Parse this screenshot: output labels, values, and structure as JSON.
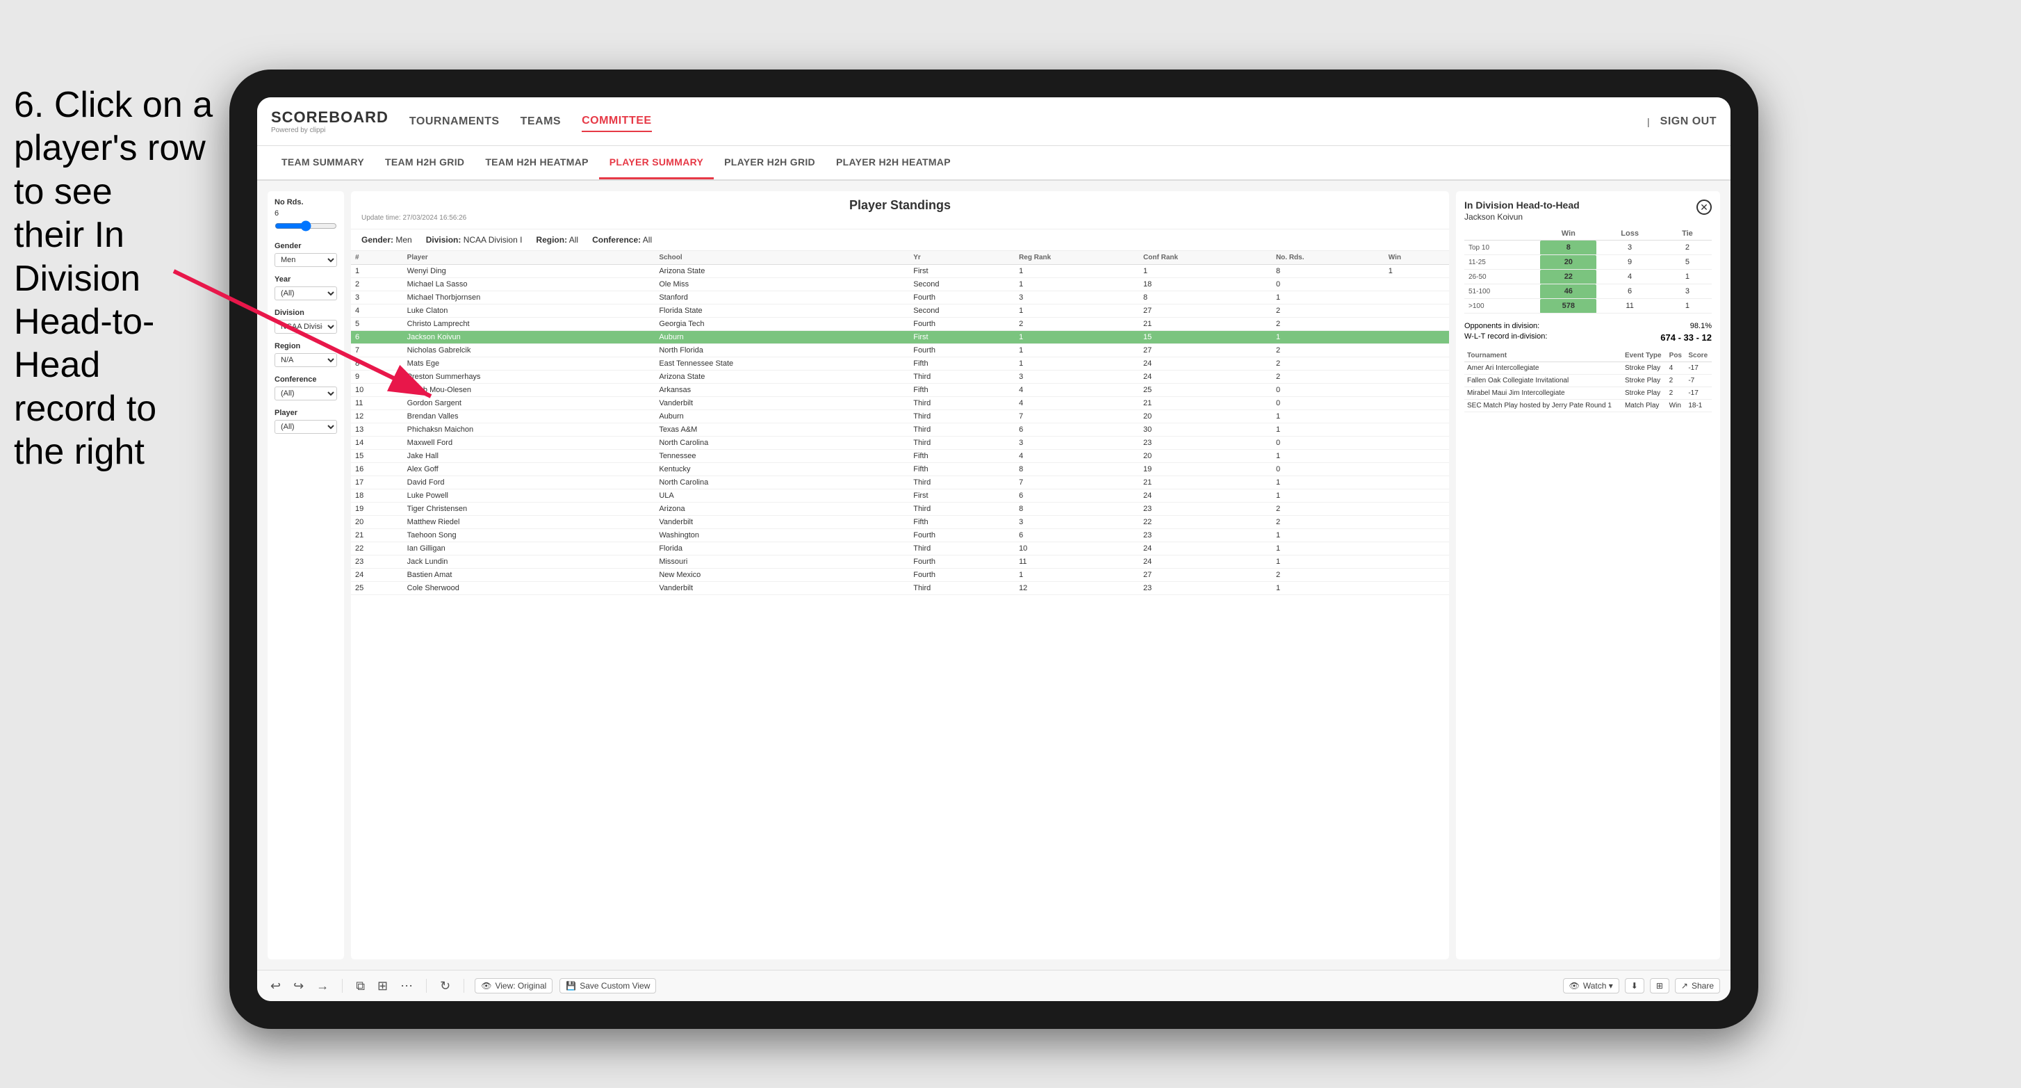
{
  "instruction": {
    "line1": "6. Click on a",
    "line2": "player's row to see",
    "line3": "their In Division",
    "line4": "Head-to-Head",
    "line5": "record to the right"
  },
  "nav": {
    "logo": "SCOREBOARD",
    "logo_sub": "Powered by clippi",
    "items": [
      "TOURNAMENTS",
      "TEAMS",
      "COMMITTEE"
    ],
    "sign_in": "Sign out"
  },
  "sub_nav": {
    "items": [
      "TEAM SUMMARY",
      "TEAM H2H GRID",
      "TEAM H2H HEATMAP",
      "PLAYER SUMMARY",
      "PLAYER H2H GRID",
      "PLAYER H2H HEATMAP"
    ],
    "active": "PLAYER SUMMARY"
  },
  "filters": {
    "no_rds_label": "No Rds.",
    "no_rds_value": "6",
    "gender_label": "Gender",
    "gender_value": "Men",
    "year_label": "Year",
    "year_value": "(All)",
    "division_label": "Division",
    "division_value": "NCAA Division I",
    "region_label": "Region",
    "region_value": "N/A",
    "conference_label": "Conference",
    "conference_value": "(All)",
    "player_label": "Player",
    "player_value": "(All)"
  },
  "standings": {
    "title": "Player Standings",
    "update_time": "Update time:",
    "update_value": "27/03/2024 16:56:26",
    "gender_label": "Gender:",
    "gender_value": "Men",
    "division_label": "Division:",
    "division_value": "NCAA Division I",
    "region_label": "Region:",
    "region_value": "All",
    "conference_label": "Conference:",
    "conference_value": "All",
    "columns": [
      "#",
      "Player",
      "School",
      "Yr",
      "Reg Rank",
      "Conf Rank",
      "No. Rds.",
      "Win"
    ],
    "rows": [
      {
        "num": 1,
        "player": "Wenyi Ding",
        "school": "Arizona State",
        "yr": "First",
        "reg": 1,
        "conf": 1,
        "rds": 8,
        "win": 1
      },
      {
        "num": 2,
        "player": "Michael La Sasso",
        "school": "Ole Miss",
        "yr": "Second",
        "reg": 1,
        "conf": 18,
        "rds": 0
      },
      {
        "num": 3,
        "player": "Michael Thorbjornsen",
        "school": "Stanford",
        "yr": "Fourth",
        "reg": 3,
        "conf": 8,
        "rds": 1
      },
      {
        "num": 4,
        "player": "Luke Claton",
        "school": "Florida State",
        "yr": "Second",
        "reg": 1,
        "conf": 27,
        "rds": 2
      },
      {
        "num": 5,
        "player": "Christo Lamprecht",
        "school": "Georgia Tech",
        "yr": "Fourth",
        "reg": 2,
        "conf": 21,
        "rds": 2
      },
      {
        "num": 6,
        "player": "Jackson Koivun",
        "school": "Auburn",
        "yr": "First",
        "reg": 1,
        "conf": 15,
        "rds": 1,
        "highlighted": true
      },
      {
        "num": 7,
        "player": "Nicholas Gabrelcik",
        "school": "North Florida",
        "yr": "Fourth",
        "reg": 1,
        "conf": 27,
        "rds": 2
      },
      {
        "num": 8,
        "player": "Mats Ege",
        "school": "East Tennessee State",
        "yr": "Fifth",
        "reg": 1,
        "conf": 24,
        "rds": 2
      },
      {
        "num": 9,
        "player": "Preston Summerhays",
        "school": "Arizona State",
        "yr": "Third",
        "reg": 3,
        "conf": 24,
        "rds": 2
      },
      {
        "num": 10,
        "player": "Jacob Mou-Olesen",
        "school": "Arkansas",
        "yr": "Fifth",
        "reg": 4,
        "conf": 25,
        "rds": 0
      },
      {
        "num": 11,
        "player": "Gordon Sargent",
        "school": "Vanderbilt",
        "yr": "Third",
        "reg": 4,
        "conf": 21,
        "rds": 0
      },
      {
        "num": 12,
        "player": "Brendan Valles",
        "school": "Auburn",
        "yr": "Third",
        "reg": 7,
        "conf": 20,
        "rds": 1
      },
      {
        "num": 13,
        "player": "Phichaksn Maichon",
        "school": "Texas A&M",
        "yr": "Third",
        "reg": 6,
        "conf": 30,
        "rds": 1
      },
      {
        "num": 14,
        "player": "Maxwell Ford",
        "school": "North Carolina",
        "yr": "Third",
        "reg": 3,
        "conf": 23,
        "rds": 0
      },
      {
        "num": 15,
        "player": "Jake Hall",
        "school": "Tennessee",
        "yr": "Fifth",
        "reg": 4,
        "conf": 20,
        "rds": 1
      },
      {
        "num": 16,
        "player": "Alex Goff",
        "school": "Kentucky",
        "yr": "Fifth",
        "reg": 8,
        "conf": 19,
        "rds": 0
      },
      {
        "num": 17,
        "player": "David Ford",
        "school": "North Carolina",
        "yr": "Third",
        "reg": 7,
        "conf": 21,
        "rds": 1
      },
      {
        "num": 18,
        "player": "Luke Powell",
        "school": "ULA",
        "yr": "First",
        "reg": 6,
        "conf": 24,
        "rds": 1
      },
      {
        "num": 19,
        "player": "Tiger Christensen",
        "school": "Arizona",
        "yr": "Third",
        "reg": 8,
        "conf": 23,
        "rds": 2
      },
      {
        "num": 20,
        "player": "Matthew Riedel",
        "school": "Vanderbilt",
        "yr": "Fifth",
        "reg": 3,
        "conf": 22,
        "rds": 2
      },
      {
        "num": 21,
        "player": "Taehoon Song",
        "school": "Washington",
        "yr": "Fourth",
        "reg": 6,
        "conf": 23,
        "rds": 1
      },
      {
        "num": 22,
        "player": "Ian Gilligan",
        "school": "Florida",
        "yr": "Third",
        "reg": 10,
        "conf": 24,
        "rds": 1
      },
      {
        "num": 23,
        "player": "Jack Lundin",
        "school": "Missouri",
        "yr": "Fourth",
        "reg": 11,
        "conf": 24,
        "rds": 1
      },
      {
        "num": 24,
        "player": "Bastien Amat",
        "school": "New Mexico",
        "yr": "Fourth",
        "reg": 1,
        "conf": 27,
        "rds": 2
      },
      {
        "num": 25,
        "player": "Cole Sherwood",
        "school": "Vanderbilt",
        "yr": "Third",
        "reg": 12,
        "conf": 23,
        "rds": 1
      }
    ]
  },
  "h2h": {
    "title": "In Division Head-to-Head",
    "player_name": "Jackson Koivun",
    "table_headers": [
      "Win",
      "Loss",
      "Tie"
    ],
    "rows": [
      {
        "label": "Top 10",
        "win": 8,
        "loss": 3,
        "tie": 2
      },
      {
        "label": "11-25",
        "win": 20,
        "loss": 9,
        "tie": 5
      },
      {
        "label": "26-50",
        "win": 22,
        "loss": 4,
        "tie": 1
      },
      {
        "label": "51-100",
        "win": 46,
        "loss": 6,
        "tie": 3
      },
      {
        "label": ">100",
        "win": 578,
        "loss": 11,
        "tie": 1
      }
    ],
    "opponents_label": "Opponents in division:",
    "opponents_value": "98.1%",
    "wlt_label": "W-L-T record in-division:",
    "wlt_value": "674 - 33 - 12",
    "tournaments_columns": [
      "Tournament",
      "Event Type",
      "Pos",
      "Score"
    ],
    "tournaments": [
      {
        "name": "Amer Ari Intercollegiate",
        "type": "Stroke Play",
        "pos": 4,
        "score": "-17"
      },
      {
        "name": "Fallen Oak Collegiate Invitational",
        "type": "Stroke Play",
        "pos": 2,
        "score": "-7"
      },
      {
        "name": "Mirabel Maui Jim Intercollegiate",
        "type": "Stroke Play",
        "pos": 2,
        "score": "-17"
      },
      {
        "name": "SEC Match Play hosted by Jerry Pate Round 1",
        "type": "Match Play",
        "pos": "Win",
        "score": "18-1"
      }
    ]
  },
  "toolbar": {
    "undo": "↩",
    "redo": "↪",
    "forward": "→",
    "copy": "⧉",
    "paste": "⊞",
    "more": "⋯",
    "refresh": "↻",
    "view_original": "View: Original",
    "save_custom": "Save Custom View",
    "watch": "Watch ▾",
    "export_icon": "⬇",
    "grid_icon": "⊞",
    "share": "Share"
  }
}
